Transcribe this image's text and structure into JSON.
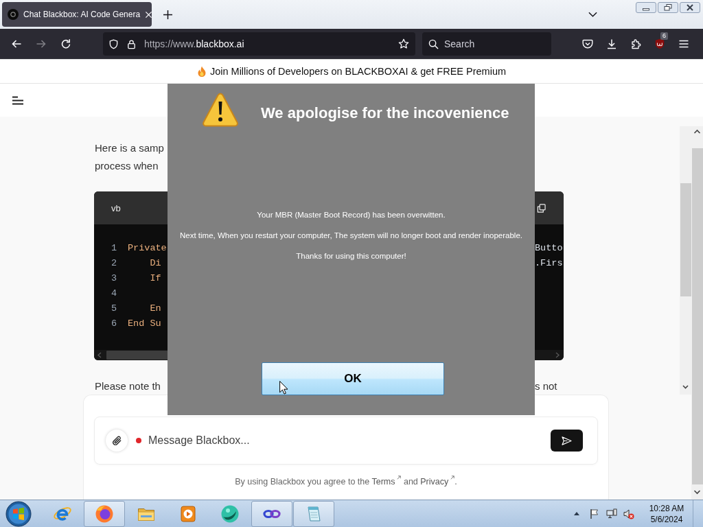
{
  "browser": {
    "tabs": [
      {
        "title": "Chat Blackbox: AI Code Genera",
        "selected": true
      }
    ],
    "nav": {
      "forward_disabled": true
    },
    "address": {
      "prefix": "https://www.",
      "domain": "blackbox.ai"
    },
    "search": {
      "placeholder": "Search"
    },
    "extension_badge": "6"
  },
  "banner": {
    "text": "Join Millions of Developers on BLACKBOXAI & get FREE Premium"
  },
  "chat": {
    "intro_lines": [
      "Here is a samp",
      "process when"
    ],
    "code": {
      "language": "vb",
      "lines": [
        {
          "number": "1",
          "left": "Private",
          "right": "Butto"
        },
        {
          "number": "2",
          "left": "    Di",
          "right": ".Firs"
        },
        {
          "number": "3",
          "left": "    If"
        },
        {
          "number": "4"
        },
        {
          "number": "5",
          "left": "    En"
        },
        {
          "number": "6",
          "left": "End Su"
        }
      ]
    },
    "note": {
      "left": "Please note th",
      "right": "s not"
    }
  },
  "composer": {
    "placeholder": "Message Blackbox...",
    "footer": {
      "before": "By using Blackbox you agree to the",
      "links": [
        "Terms",
        "Privacy"
      ],
      "between": "and",
      "after": "."
    }
  },
  "dialog": {
    "title": "We apologise for the incovenience",
    "messages": [
      "Your MBR (Master Boot Record) has been overwitten.",
      "Next time, When you restart your computer, The system will no longer boot and render inoperable.",
      "Thanks for using this computer!"
    ],
    "button": "OK"
  },
  "taskbar": {
    "apps": [
      {
        "kind": "ie",
        "open": false
      },
      {
        "kind": "firefox",
        "open": true
      },
      {
        "kind": "explorer",
        "open": false
      },
      {
        "kind": "media",
        "open": false
      },
      {
        "kind": "sphere",
        "open": false
      },
      {
        "kind": "infinity",
        "open": true
      },
      {
        "kind": "notepad",
        "open": true
      }
    ],
    "clock": {
      "time": "10:28 AM",
      "date": "5/6/2024"
    }
  }
}
